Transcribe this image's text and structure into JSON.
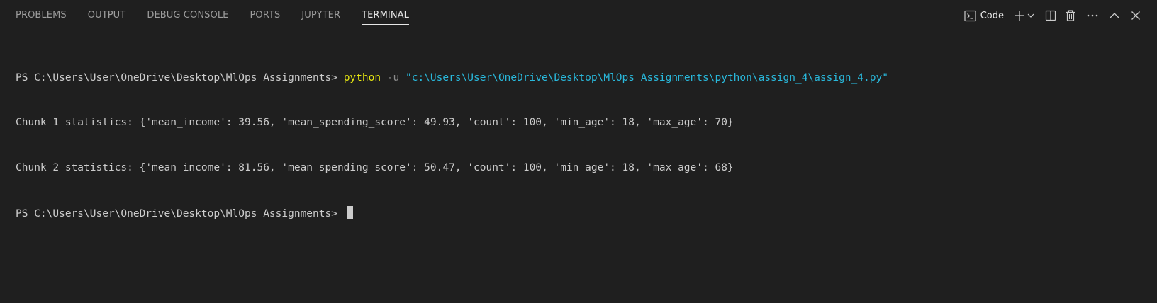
{
  "tabs": [
    {
      "label": "PROBLEMS",
      "active": false
    },
    {
      "label": "OUTPUT",
      "active": false
    },
    {
      "label": "DEBUG CONSOLE",
      "active": false
    },
    {
      "label": "PORTS",
      "active": false
    },
    {
      "label": "JUPYTER",
      "active": false
    },
    {
      "label": "TERMINAL",
      "active": true
    }
  ],
  "actions": {
    "profile_label": "Code",
    "icons": [
      "terminal-icon",
      "plus-icon",
      "chevron-down-icon",
      "split-icon",
      "trash-icon",
      "more-icon",
      "maximize-icon",
      "close-icon"
    ]
  },
  "terminal": {
    "prompt": "PS C:\\Users\\User\\OneDrive\\Desktop\\MlOps Assignments> ",
    "command": {
      "program": "python",
      "flag": " -u ",
      "path": "\"c:\\Users\\User\\OneDrive\\Desktop\\MlOps Assignments\\python\\assign_4\\assign_4.py\""
    },
    "output": [
      "Chunk 1 statistics: {'mean_income': 39.56, 'mean_spending_score': 49.93, 'count': 100, 'min_age': 18, 'max_age': 70}",
      "Chunk 2 statistics: {'mean_income': 81.56, 'mean_spending_score': 50.47, 'count': 100, 'min_age': 18, 'max_age': 68}"
    ],
    "final_prompt": "PS C:\\Users\\User\\OneDrive\\Desktop\\MlOps Assignments> "
  },
  "colors": {
    "background": "#1f1f1f",
    "text": "#cccccc",
    "python": "#e5e510",
    "flag": "#8c8c8c",
    "path": "#29b8db",
    "tab_inactive": "#9d9d9d",
    "tab_active": "#e7e7e7"
  }
}
